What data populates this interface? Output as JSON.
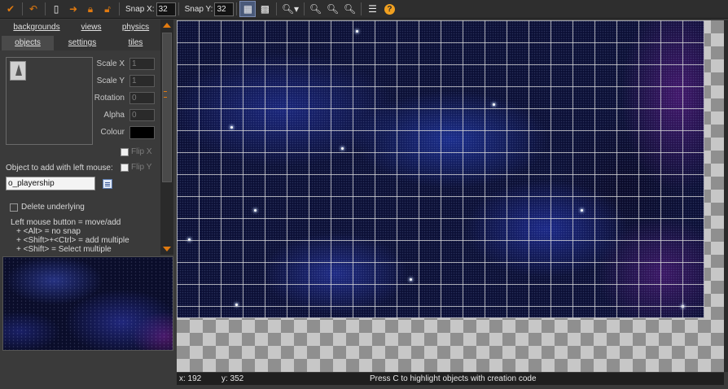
{
  "toolbar": {
    "snap_x_label": "Snap X:",
    "snap_x_value": "32",
    "snap_y_label": "Snap Y:",
    "snap_y_value": "32",
    "icons": [
      "checkmark-icon",
      "undo-icon",
      "new-icon",
      "arrow-right-icon",
      "lock-icon",
      "unlock-icon",
      "grid-icon",
      "isometric-grid-icon",
      "magnifier-icon",
      "zoom-in-icon",
      "zoom-out-icon",
      "zoom-reset-icon",
      "list-icon",
      "help-icon"
    ],
    "colors": {
      "accent": "#e07a10",
      "help": "#f0a020"
    }
  },
  "tabs": [
    {
      "label": "backgrounds",
      "selected": false
    },
    {
      "label": "views",
      "selected": false
    },
    {
      "label": "physics",
      "selected": false
    },
    {
      "label": "objects",
      "selected": true
    },
    {
      "label": "settings",
      "selected": false
    },
    {
      "label": "tiles",
      "selected": false
    }
  ],
  "object_props": {
    "scale_x_label": "Scale X",
    "scale_x_value": "1",
    "scale_y_label": "Scale Y",
    "scale_y_value": "1",
    "rotation_label": "Rotation",
    "rotation_value": "0",
    "alpha_label": "Alpha",
    "alpha_value": "0",
    "colour_label": "Colour",
    "colour_value": "#000000",
    "flip_x_label": "Flip X",
    "flip_y_label": "Flip Y"
  },
  "object_add": {
    "label": "Object to add with left mouse:",
    "value": "o_playership"
  },
  "delete_underlying_label": "Delete underlying",
  "help_lines": [
    "Left mouse button = move/add",
    "+ <Alt> = no snap",
    "+ <Shift>+<Ctrl> = add multiple",
    "+ <Shift> = Select multiple"
  ],
  "status": {
    "x": "x: 192",
    "y": "y: 352",
    "message": "Press C to highlight objects with creation code"
  }
}
